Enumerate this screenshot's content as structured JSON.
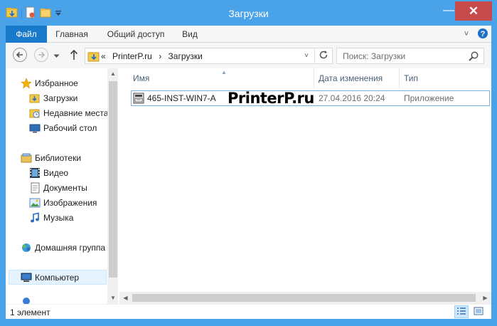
{
  "window": {
    "title": "Загрузки",
    "close_glyph": "✕",
    "minimize_glyph": "—",
    "accent_color": "#4aa2e8",
    "close_color": "#c74b4b"
  },
  "ribbon": {
    "tabs": [
      {
        "label": "Файл",
        "active": true
      },
      {
        "label": "Главная"
      },
      {
        "label": "Общий доступ"
      },
      {
        "label": "Вид"
      }
    ],
    "expand_glyph": "˅",
    "help_icon": "help-icon"
  },
  "navigation": {
    "back_icon": "back-arrow-icon",
    "forward_icon": "forward-arrow-icon",
    "recent_icon": "chevron-down-icon",
    "up_icon": "up-arrow-icon",
    "address": {
      "overflow": "«",
      "segments": [
        "PrinterP.ru",
        "›",
        "Загрузки"
      ],
      "dropdown_glyph": "˅"
    },
    "search_placeholder": "Поиск: Загрузки"
  },
  "sidebar": {
    "favorites": {
      "label": "Избранное",
      "items": [
        {
          "label": "Загрузки",
          "icon": "downloads-folder-icon"
        },
        {
          "label": "Недавние места",
          "icon": "recent-places-icon"
        },
        {
          "label": "Рабочий стол",
          "icon": "desktop-icon"
        }
      ]
    },
    "libraries": {
      "label": "Библиотеки",
      "items": [
        {
          "label": "Видео",
          "icon": "video-icon"
        },
        {
          "label": "Документы",
          "icon": "documents-icon"
        },
        {
          "label": "Изображения",
          "icon": "pictures-icon"
        },
        {
          "label": "Музыка",
          "icon": "music-icon"
        }
      ]
    },
    "homegroup": {
      "label": "Домашняя группа"
    },
    "computer": {
      "label": "Компьютер",
      "selected": true
    }
  },
  "file_list": {
    "columns": [
      "Имя",
      "Дата изменения",
      "Тип"
    ],
    "sorted_by": "Имя",
    "rows": [
      {
        "name": "465-INST-WIN7-A",
        "modified": "27.04.2016 20:24",
        "type": "Приложение",
        "icon": "installer-icon"
      }
    ]
  },
  "watermark": "PrinterP.ru",
  "status": {
    "item_count": "1 элемент",
    "view_buttons": [
      "details-view-icon",
      "large-icons-view-icon"
    ]
  }
}
